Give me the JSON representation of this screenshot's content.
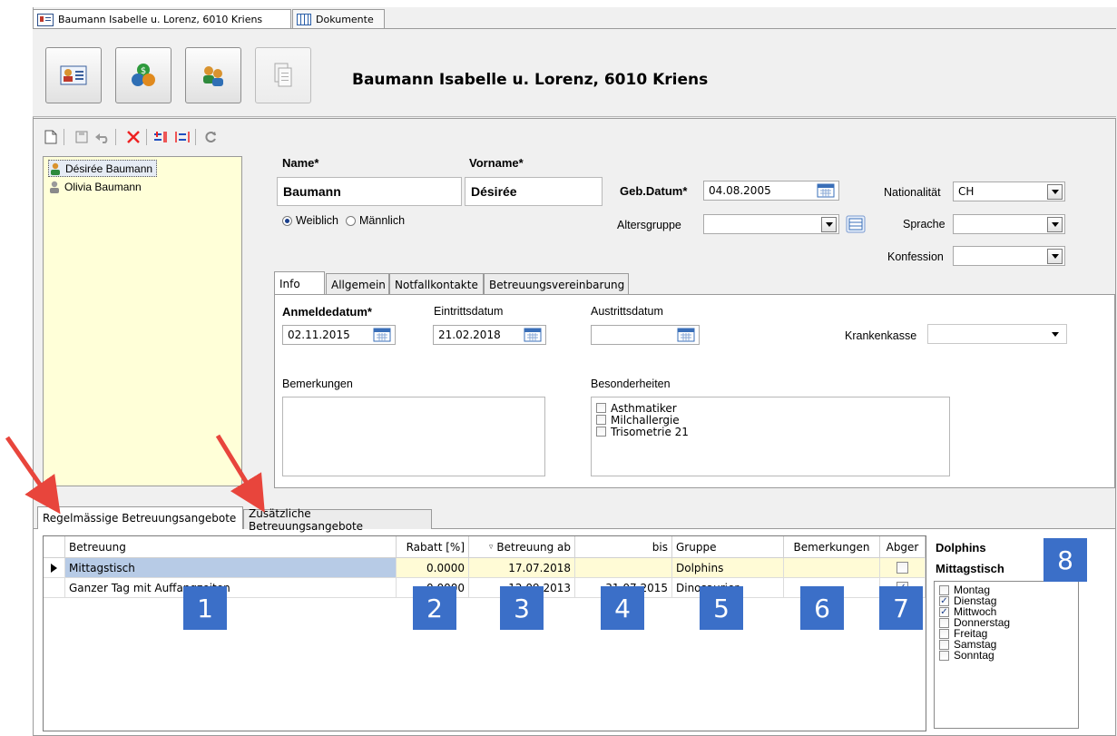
{
  "doc_tabs": [
    {
      "label": "Baumann Isabelle u. Lorenz, 6010 Kriens"
    },
    {
      "label": "Dokumente"
    }
  ],
  "header": {
    "title": "Baumann Isabelle u. Lorenz, 6010 Kriens"
  },
  "children": [
    {
      "label": "Désirée Baumann"
    },
    {
      "label": "Olivia Baumann"
    }
  ],
  "form": {
    "name_label": "Name*",
    "name_value": "Baumann",
    "vorname_label": "Vorname*",
    "vorname_value": "Désirée",
    "gender_female": "Weiblich",
    "gender_male": "Männlich",
    "gebdatum_label": "Geb.Datum*",
    "gebdatum_value": "04.08.2005",
    "altersgruppe_label": "Altersgruppe",
    "altersgruppe_value": "",
    "nationalitaet_label": "Nationalität",
    "nationalitaet_value": "CH",
    "sprache_label": "Sprache",
    "sprache_value": "",
    "konfession_label": "Konfession",
    "konfession_value": ""
  },
  "info_tabs": [
    {
      "label": "Info"
    },
    {
      "label": "Allgemein"
    },
    {
      "label": "Notfallkontakte"
    },
    {
      "label": "Betreuungsvereinbarung"
    }
  ],
  "info": {
    "anmeldedatum_label": "Anmeldedatum*",
    "anmeldedatum_value": "02.11.2015",
    "eintrittsdatum_label": "Eintrittsdatum",
    "eintrittsdatum_value": "21.02.2018",
    "austrittsdatum_label": "Austrittsdatum",
    "austrittsdatum_value": "",
    "krankenkasse_label": "Krankenkasse",
    "krankenkasse_value": "",
    "bemerkungen_label": "Bemerkungen",
    "besonderheiten_label": "Besonderheiten",
    "besonderheiten": [
      {
        "label": "Asthmatiker",
        "checked": false
      },
      {
        "label": "Milchallergie",
        "checked": false
      },
      {
        "label": "Trisometrie 21",
        "checked": false
      }
    ]
  },
  "bottom_tabs": [
    {
      "label": "Regelmässige Betreuungsangebote"
    },
    {
      "label": "Zusätzliche Betreuungsangebote"
    }
  ],
  "grid": {
    "columns": [
      "Betreuung",
      "Rabatt [%]",
      "Betreuung ab",
      "bis",
      "Gruppe",
      "Bemerkungen",
      "Abger"
    ],
    "rows": [
      {
        "betreuung": "Mittagstisch",
        "rabatt": "0.0000",
        "ab": "17.07.2018",
        "bis": "",
        "gruppe": "Dolphins",
        "bemerkungen": "",
        "abger": false
      },
      {
        "betreuung": "Ganzer Tag mit Auffangzeiten",
        "rabatt": "0.0000",
        "ab": "12.09.2013",
        "bis": "31.07.2015",
        "gruppe": "Dinosaurier",
        "bemerkungen": "",
        "abger": true
      }
    ]
  },
  "side": {
    "group": "Dolphins",
    "offer": "Mittagstisch",
    "days": [
      {
        "label": "Montag",
        "checked": false
      },
      {
        "label": "Dienstag",
        "checked": true
      },
      {
        "label": "Mittwoch",
        "checked": true
      },
      {
        "label": "Donnerstag",
        "checked": false
      },
      {
        "label": "Freitag",
        "checked": false
      },
      {
        "label": "Samstag",
        "checked": false
      },
      {
        "label": "Sonntag",
        "checked": false
      }
    ]
  },
  "badges": [
    "1",
    "2",
    "3",
    "4",
    "5",
    "6",
    "7",
    "8"
  ],
  "colors": {
    "accent": "#3b6fc8",
    "arrow": "#e8453c",
    "list_bg": "#ffffd8",
    "selected_row": "#b7cbe6"
  }
}
